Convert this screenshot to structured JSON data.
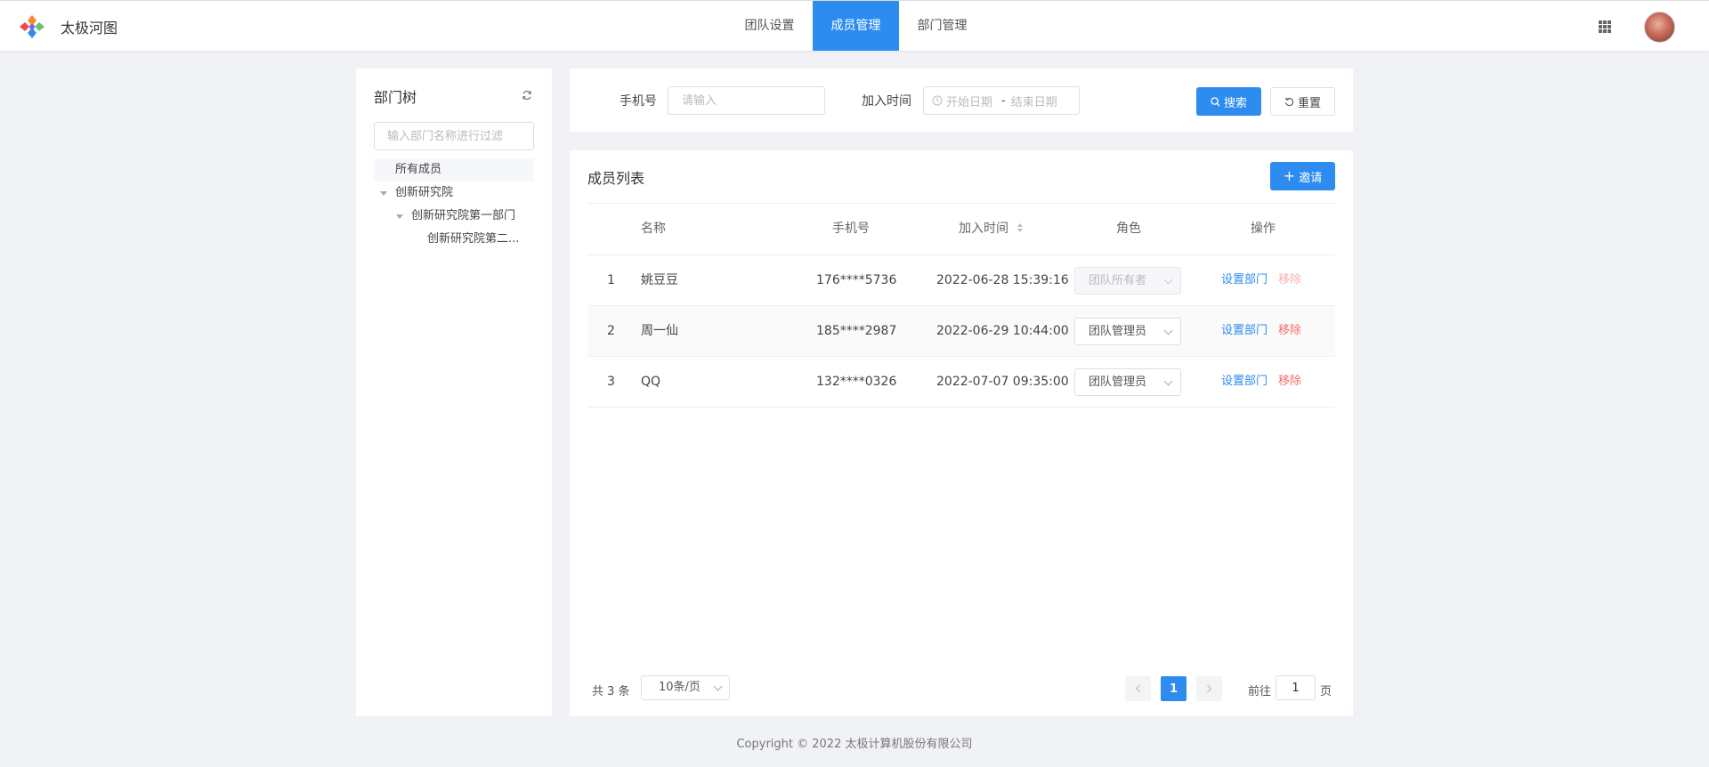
{
  "app": {
    "title": "太极河图"
  },
  "nav": {
    "tabs": [
      {
        "label": "团队设置"
      },
      {
        "label": "成员管理"
      },
      {
        "label": "部门管理"
      }
    ],
    "active_index": 1
  },
  "header": {
    "apps_icon": "grid-icon",
    "avatar_icon": "user-avatar"
  },
  "sidebar": {
    "title": "部门树",
    "refresh_icon": "refresh-icon",
    "filter_placeholder": "输入部门名称进行过滤",
    "tree": [
      {
        "label": "所有成员",
        "level": 0,
        "selected": true
      },
      {
        "label": "创新研究院",
        "level": 0,
        "expanded": true
      },
      {
        "label": "创新研究院第一部门",
        "level": 1,
        "expanded": true
      },
      {
        "label": "创新研究院第二...",
        "level": 2
      }
    ]
  },
  "search": {
    "phone_label": "手机号",
    "phone_placeholder": "请输入",
    "join_time_label": "加入时间",
    "start_placeholder": "开始日期",
    "separator": "-",
    "end_placeholder": "结束日期",
    "search_button": "搜索",
    "reset_button": "重置"
  },
  "list": {
    "title": "成员列表",
    "invite_button": "邀请",
    "columns": {
      "name": "名称",
      "phone": "手机号",
      "join_time": "加入时间",
      "role": "角色",
      "actions": "操作"
    },
    "rows": [
      {
        "index": "1",
        "name": "姚豆豆",
        "phone": "176****5736",
        "join_time": "2022-06-28 15:39:16",
        "role": "团队所有者",
        "role_disabled": true,
        "set_dept": "设置部门",
        "remove": "移除",
        "remove_disabled": true
      },
      {
        "index": "2",
        "name": "周一仙",
        "phone": "185****2987",
        "join_time": "2022-06-29 10:44:00",
        "role": "团队管理员",
        "role_disabled": false,
        "set_dept": "设置部门",
        "remove": "移除",
        "remove_disabled": false
      },
      {
        "index": "3",
        "name": "QQ",
        "phone": "132****0326",
        "join_time": "2022-07-07 09:35:00",
        "role": "团队管理员",
        "role_disabled": false,
        "set_dept": "设置部门",
        "remove": "移除",
        "remove_disabled": false
      }
    ]
  },
  "pagination": {
    "total_text": "共 3 条",
    "page_size": "10条/页",
    "current_page": "1",
    "goto_prefix": "前往",
    "goto_value": "1",
    "goto_suffix": "页"
  },
  "footer": {
    "copyright": "Copyright © 2022 太极计算机股份有限公司"
  },
  "colors": {
    "primary": "#2d8cf0",
    "danger": "#f56c6c",
    "danger_disabled": "#f5b0b0",
    "link": "#2d8cf0"
  }
}
